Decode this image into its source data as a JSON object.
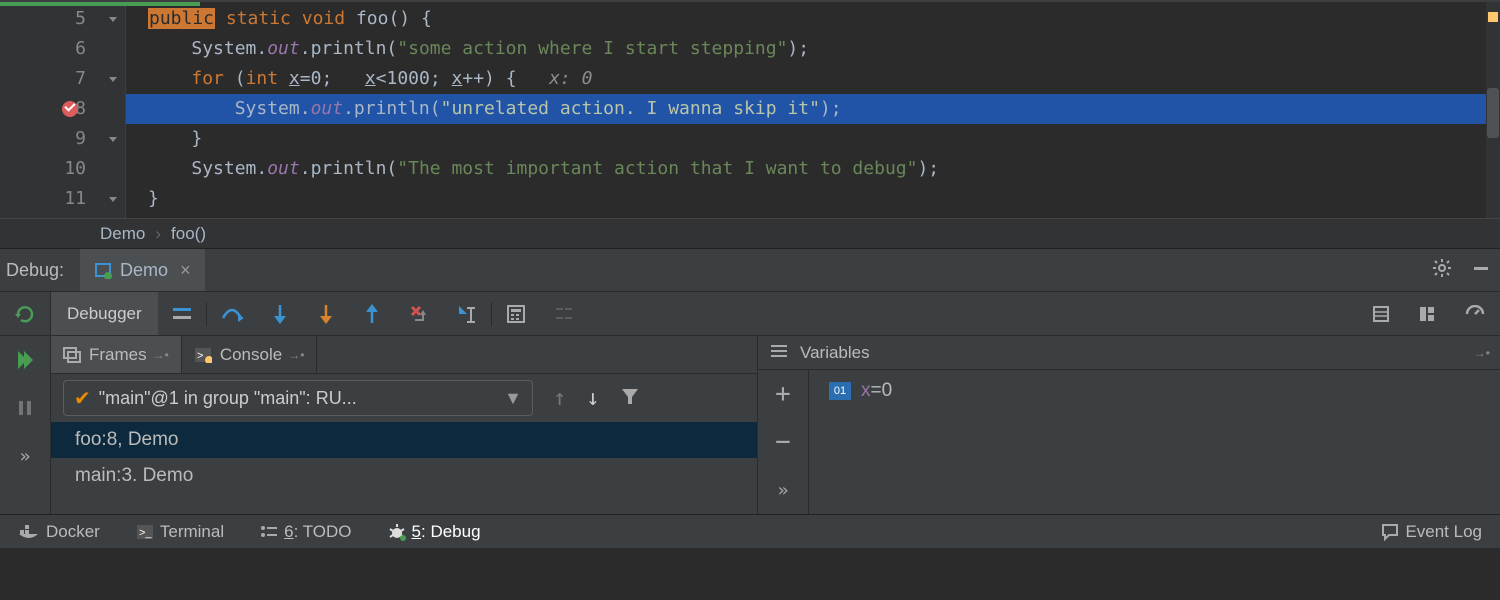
{
  "editor": {
    "lines": {
      "l5": {
        "num": "5"
      },
      "l6": {
        "num": "6"
      },
      "l7": {
        "num": "7"
      },
      "l8": {
        "num": "8"
      },
      "l9": {
        "num": "9"
      },
      "l10": {
        "num": "10"
      },
      "l11": {
        "num": "11"
      }
    },
    "tok": {
      "public": "public",
      "static": "static",
      "void": "void",
      "foo_sig": " foo() {",
      "sys": "System.",
      "out": "out",
      "println": ".println(",
      "str1": "\"some action where I start stepping\"",
      "close_stmt": ");",
      "for": "for",
      "for_open": " (",
      "int": "int",
      "sp": " ",
      "x": "x",
      "eq0": "=0",
      "sc": ";   ",
      "lt1000": "<1000; ",
      "pp_close": "++) {   ",
      "hint_x": "x: 0",
      "str2": "\"unrelated action. I wanna skip it\"",
      "brace_close": "}",
      "str3": "\"The most important action that I want to debug\""
    }
  },
  "breadcrumb": {
    "a": "Demo",
    "b": "foo()"
  },
  "debug": {
    "title": "Debug:",
    "run_tab": "Demo",
    "debugger_tab": "Debugger"
  },
  "frames": {
    "tabs": {
      "frames": "Frames",
      "console": "Console"
    },
    "thread": "\"main\"@1 in group \"main\": RU...",
    "list": [
      {
        "text": "foo:8, Demo",
        "selected": true
      },
      {
        "text": "main:3. Demo",
        "selected": false
      }
    ]
  },
  "variables": {
    "title": "Variables",
    "items": [
      {
        "badge": "01",
        "name": "x",
        "eq": " = ",
        "value": "0"
      }
    ]
  },
  "status": {
    "docker": "Docker",
    "terminal": "Terminal",
    "todo_pref": "6",
    "todo_suf": ": TODO",
    "debug_pref": "5",
    "debug_suf": ": Debug",
    "eventlog": "Event Log"
  }
}
